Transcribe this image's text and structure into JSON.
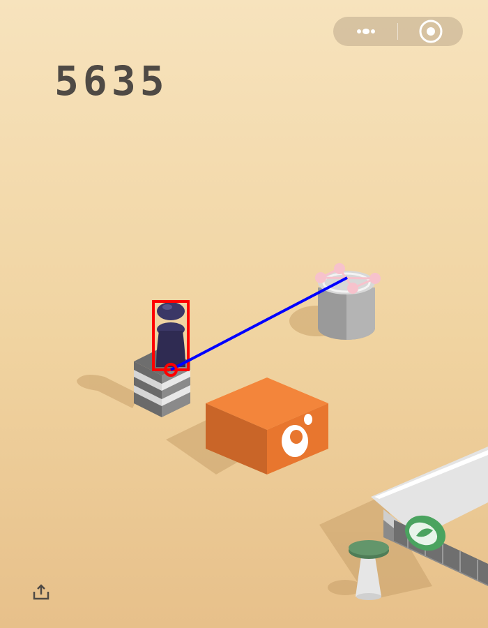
{
  "game": {
    "score": "5635"
  },
  "header": {
    "menu_icon": "more-dots-icon",
    "close_icon": "target-close-icon"
  },
  "footer": {
    "share_icon": "share-upload-icon"
  },
  "colors": {
    "background": "#f2d8a8",
    "score_text": "#4f4a45",
    "orange_block": "#f08237",
    "trajectory_line": "#0000ff",
    "player_box": "#ff0000",
    "player": "#2f2b52"
  }
}
